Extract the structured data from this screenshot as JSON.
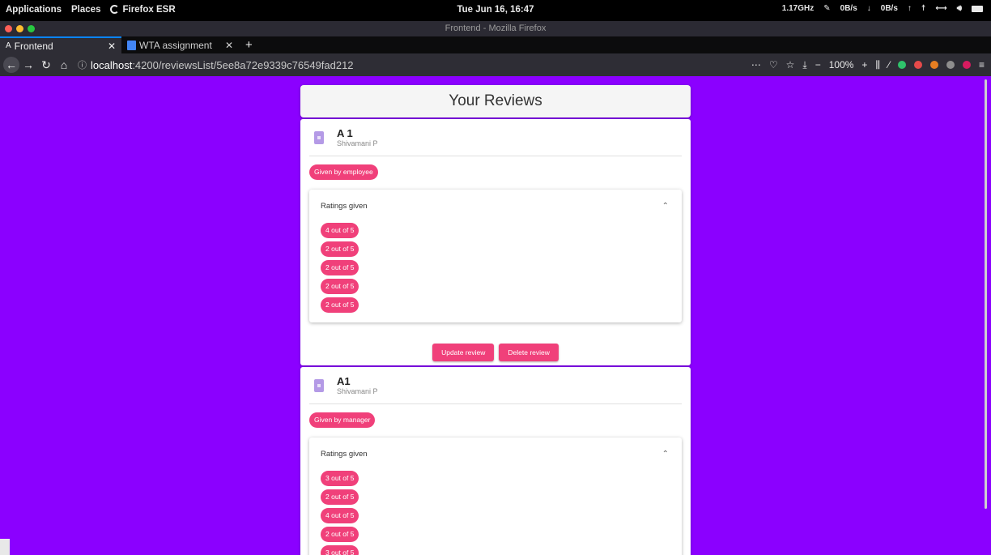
{
  "system_bar": {
    "applications": "Applications",
    "places": "Places",
    "app_name": "Firefox ESR",
    "clock": "Tue Jun 16, 16:47",
    "cpu": "1.17GHz",
    "net_down": "0B/s",
    "net_up": "0B/s"
  },
  "window": {
    "title": "Frontend - Mozilla Firefox"
  },
  "tabs": [
    {
      "favicon": "A",
      "title": "Frontend",
      "active": true
    },
    {
      "favicon": "docs-icon",
      "title": "WTA assignment",
      "active": false
    }
  ],
  "navbar": {
    "url_host": "localhost",
    "url_path": ":4200/reviewsList/5ee8a72e9339c76549fad212",
    "zoom": "100%"
  },
  "page": {
    "heading": "Your Reviews",
    "reviews": [
      {
        "title": "A 1",
        "subtitle": "Shivamani P",
        "given_by": "Given by employee",
        "panel_label": "Ratings given",
        "ratings": [
          "4 out of 5",
          "2 out of 5",
          "2 out of 5",
          "2 out of 5",
          "2 out of 5"
        ],
        "update_label": "Update review",
        "delete_label": "Delete review"
      },
      {
        "title": "A1",
        "subtitle": "Shivamani P",
        "given_by": "Given by manager",
        "panel_label": "Ratings given",
        "ratings": [
          "3 out of 5",
          "2 out of 5",
          "4 out of 5",
          "2 out of 5",
          "3 out of 5"
        ]
      }
    ]
  },
  "colors": {
    "page_background": "#8b00ff",
    "accent_pink": "#f0407a",
    "firefox_blue": "#0a84ff"
  }
}
